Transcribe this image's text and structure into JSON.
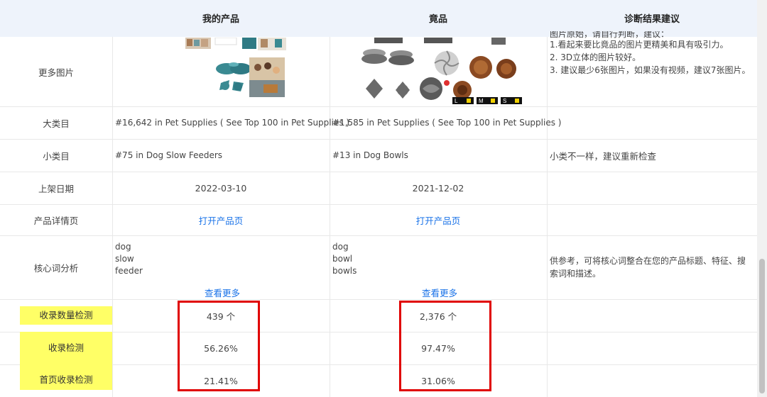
{
  "header": {
    "col_mine": "我的产品",
    "col_competitor": "竟品",
    "col_advice": "诊断结果建议"
  },
  "rows": {
    "images": {
      "label": "更多图片",
      "advice_partial": "图片原始，请自行判断，建议：",
      "advice_lines": [
        "1.看起来要比竟品的图片更精美和具有吸引力。",
        "2. 3D立体的图片较好。",
        "3. 建议最少6张图片，如果没有视频，建议7张图片。"
      ],
      "competitor_badges": [
        "L",
        "M",
        "S"
      ]
    },
    "category": {
      "label": "大类目",
      "mine": "#16,642 in Pet Supplies ( See Top 100 in Pet Supplies )",
      "competitor": "#1,585 in Pet Supplies ( See Top 100 in Pet Supplies )"
    },
    "subcategory": {
      "label": "小类目",
      "mine": "#75 in Dog Slow Feeders",
      "competitor": "#13 in Dog Bowls",
      "advice": "小类不一样，建议重新检查"
    },
    "date": {
      "label": "上架日期",
      "mine": "2022-03-10",
      "competitor": "2021-12-02"
    },
    "detail": {
      "label": "产品详情页",
      "mine_link": "打开产品页",
      "competitor_link": "打开产品页"
    },
    "keywords": {
      "label": "核心词分析",
      "mine": [
        "dog",
        "slow",
        "feeder"
      ],
      "competitor": [
        "dog",
        "bowl",
        "bowls"
      ],
      "more_mine": "查看更多",
      "more_competitor": "查看更多",
      "advice": "供参考，可将核心词整合在您的产品标题、特征、搜索词和描述。"
    },
    "index_count": {
      "label": "收录数量检测",
      "mine": "439 个",
      "competitor": "2,376 个"
    },
    "index_rate": {
      "label": "收录检测",
      "mine": "56.26%",
      "competitor": "97.47%"
    },
    "first_page": {
      "label": "首页收录检测",
      "mine": "21.41%",
      "competitor": "31.06%"
    }
  },
  "colors": {
    "header_bg": "#eef3fb",
    "link": "#1a73e8",
    "highlight": "#ffff66",
    "red_box": "#e00000",
    "teal_product": "#3a8a92",
    "brown_product": "#8b4a22"
  }
}
